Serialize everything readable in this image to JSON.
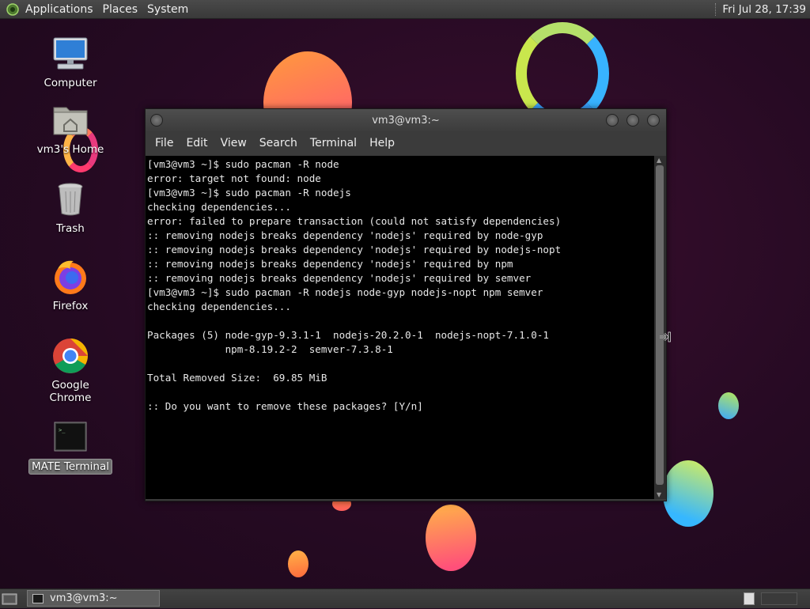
{
  "top_panel": {
    "menus": [
      "Applications",
      "Places",
      "System"
    ],
    "clock": "Fri Jul 28, 17:39"
  },
  "desktop": {
    "icons": [
      {
        "label": "Computer",
        "icon": "computer-icon"
      },
      {
        "label": "vm3's Home",
        "icon": "home-folder-icon"
      },
      {
        "label": "Trash",
        "icon": "trash-icon"
      },
      {
        "label": "Firefox",
        "icon": "firefox-icon"
      },
      {
        "label": "Google Chrome",
        "icon": "chrome-icon"
      },
      {
        "label": "MATE Terminal",
        "icon": "terminal-icon"
      }
    ]
  },
  "window": {
    "title": "vm3@vm3:~",
    "menu": [
      "File",
      "Edit",
      "View",
      "Search",
      "Terminal",
      "Help"
    ],
    "terminal_lines": [
      "[vm3@vm3 ~]$ sudo pacman -R node",
      "error: target not found: node",
      "[vm3@vm3 ~]$ sudo pacman -R nodejs",
      "checking dependencies...",
      "error: failed to prepare transaction (could not satisfy dependencies)",
      ":: removing nodejs breaks dependency 'nodejs' required by node-gyp",
      ":: removing nodejs breaks dependency 'nodejs' required by nodejs-nopt",
      ":: removing nodejs breaks dependency 'nodejs' required by npm",
      ":: removing nodejs breaks dependency 'nodejs' required by semver",
      "[vm3@vm3 ~]$ sudo pacman -R nodejs node-gyp nodejs-nopt npm semver",
      "checking dependencies...",
      "",
      "Packages (5) node-gyp-9.3.1-1  nodejs-20.2.0-1  nodejs-nopt-7.1.0-1",
      "             npm-8.19.2-2  semver-7.3.8-1",
      "",
      "Total Removed Size:  69.85 MiB",
      "",
      ":: Do you want to remove these packages? [Y/n]"
    ]
  },
  "bottom_panel": {
    "task_label": "vm3@vm3:~"
  }
}
